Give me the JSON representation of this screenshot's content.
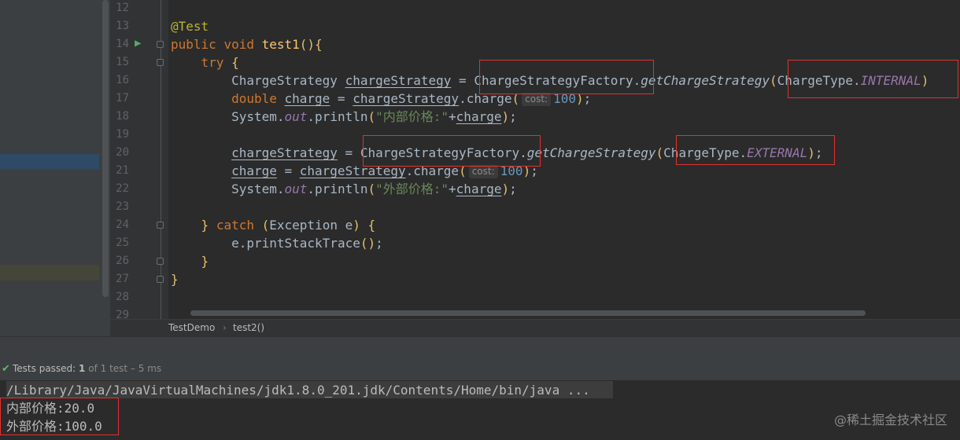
{
  "editor": {
    "line_numbers": [
      "12",
      "13",
      "14",
      "15",
      "16",
      "17",
      "18",
      "19",
      "20",
      "21",
      "22",
      "23",
      "24",
      "25",
      "26",
      "27",
      "28",
      "29"
    ],
    "annotation": "@Test",
    "kw_public": "public",
    "kw_void": "void",
    "method_name": "test1",
    "kw_try": "try",
    "type_charge_strategy": "ChargeStrategy",
    "var_charge_strategy": "chargeStrategy",
    "factory_class": "ChargeStrategyFactory",
    "factory_method": "getChargeStrategy",
    "charge_type": "ChargeType",
    "const_internal": "INTERNAL",
    "const_external": "EXTERNAL",
    "kw_double": "double",
    "var_charge": "charge",
    "charge_method": "charge",
    "hint_cost": "cost:",
    "num_100": "100",
    "system": "System",
    "out": "out",
    "println": "println",
    "str_internal": "\"内部价格:\"",
    "str_external": "\"外部价格:\"",
    "kw_catch": "catch",
    "exception": "Exception",
    "exception_var": "e",
    "print_stack": "printStackTrace"
  },
  "breadcrumbs": [
    "TestDemo",
    "test2()"
  ],
  "test_status": {
    "label": "Tests passed:",
    "passed": "1",
    "rest": "of 1 test – 5 ms"
  },
  "console": {
    "command": "/Library/Java/JavaVirtualMachines/jdk1.8.0_201.jdk/Contents/Home/bin/java ...",
    "output_internal": "内部价格:20.0",
    "output_external": "外部价格:100.0"
  },
  "watermark": "@稀土掘金技术社区",
  "colors": {
    "keyword": "#cc7832",
    "annotation": "#bbb529",
    "method": "#ffc66d",
    "string": "#6a8759",
    "number": "#6897bb",
    "static_field": "#9876aa",
    "highlight_box": "#e0322f",
    "pass_icon": "#5fb865"
  },
  "icons": [
    "run-test-icon",
    "check-icon",
    "fold-marker-icon"
  ]
}
